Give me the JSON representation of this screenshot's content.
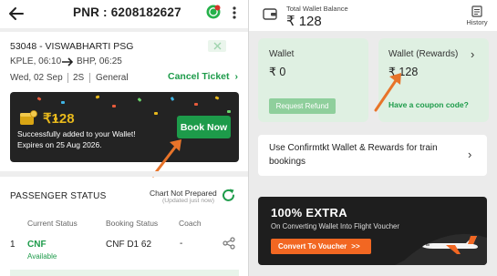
{
  "ticket": {
    "header": {
      "title": "PNR : 6208182627"
    },
    "train": {
      "name": "53048 - VISWABHARTI PSG",
      "from": "KPLE, 06:10",
      "to": "BHP, 06:25",
      "date": "Wed, 02 Sep",
      "class": "2S",
      "quota": "General",
      "cancel_label": "Cancel Ticket"
    },
    "wallet_banner": {
      "amount": "₹128",
      "message": "Successfully added to your Wallet!",
      "expiry": "Expires on 25 Aug 2026.",
      "button_label": "Book Now"
    },
    "passenger": {
      "section_title": "PASSENGER STATUS",
      "chart_status": "Chart Not Prepared",
      "chart_updated": "(Updated just now)",
      "columns": [
        "Current Status",
        "Booking Status",
        "Coach"
      ],
      "rows": [
        {
          "index": "1",
          "current_status": "CNF",
          "availability": "Available",
          "booking_status": "CNF D1 62",
          "coach": "-"
        }
      ]
    }
  },
  "wallet": {
    "header": {
      "label": "Total Wallet Balance",
      "balance": "₹ 128",
      "history_label": "History"
    },
    "wallet_card": {
      "title": "Wallet",
      "amount": "₹ 0",
      "refund_label": "Request Refund"
    },
    "rewards_card": {
      "title": "Wallet (Rewards)",
      "amount": "₹ 128",
      "coupon_label": "Have a coupon code?"
    },
    "info_text": "Use Confirmtkt Wallet & Rewards for train bookings",
    "promo": {
      "headline": "100% EXTRA",
      "subtitle": "On Converting Wallet Into Flight Voucher",
      "button_label": "Convert To Voucher",
      "button_suffix": ">>"
    }
  },
  "colors": {
    "primary_green": "#1d9b4a",
    "light_green_card": "#dff0e2",
    "banner_dark": "#232323",
    "gold": "#e8b91c",
    "orange_arrow": "#e8742a",
    "promo_orange": "#f26722"
  }
}
